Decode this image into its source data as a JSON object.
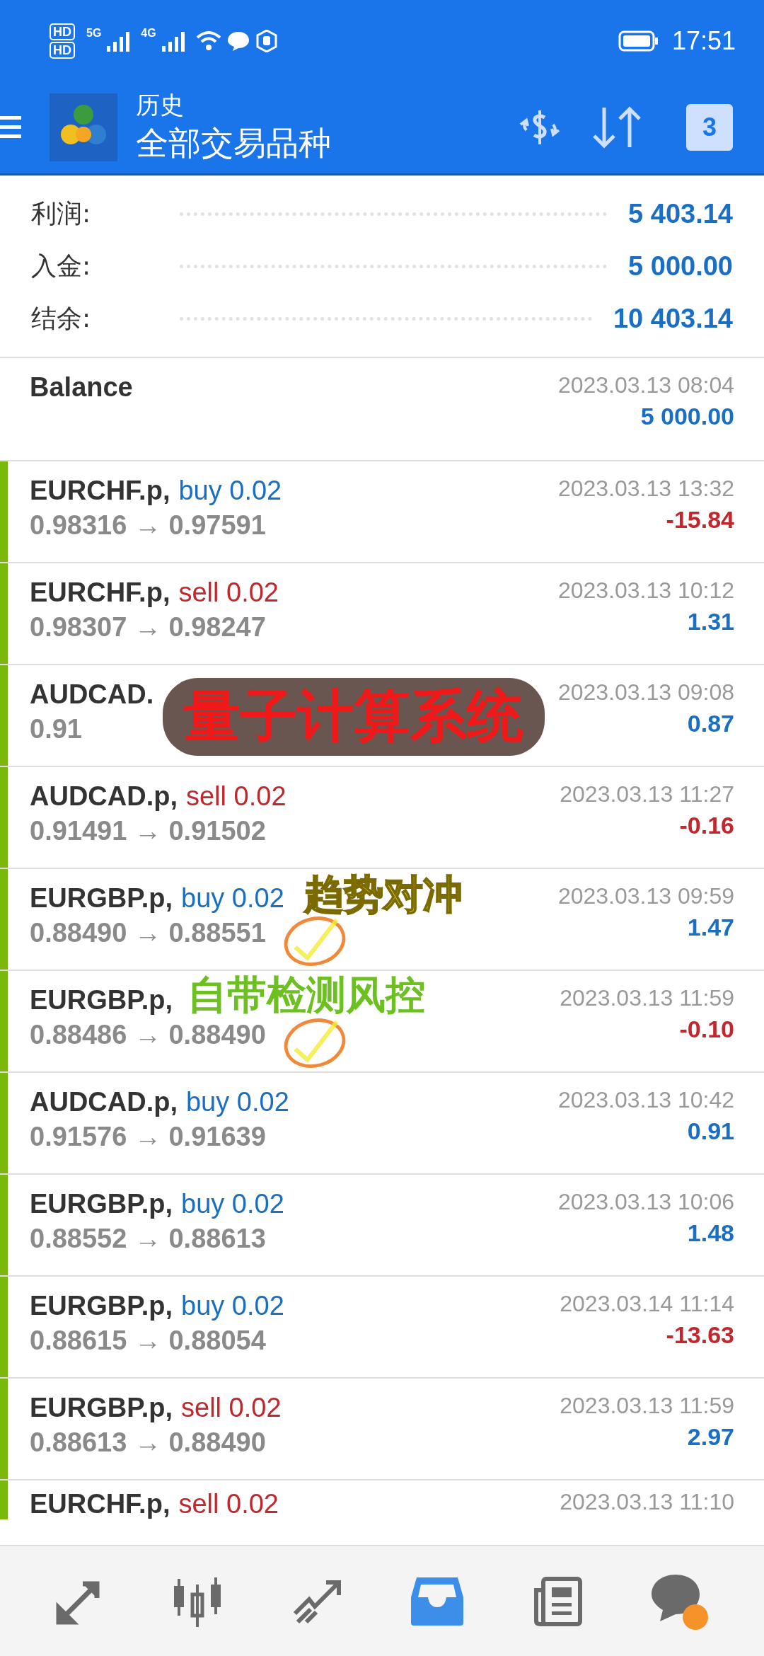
{
  "status_bar": {
    "sims": [
      "HD",
      "HD"
    ],
    "networks": [
      "5G",
      "4G"
    ],
    "time": "17:51"
  },
  "header": {
    "title": "历史",
    "subtitle": "全部交易品种",
    "calendar_day": "3"
  },
  "summary": [
    {
      "label": "利润:",
      "value": "5 403.14"
    },
    {
      "label": "入金:",
      "value": "5 000.00"
    },
    {
      "label": "结余:",
      "value": "10 403.14"
    }
  ],
  "balance": {
    "label": "Balance",
    "date": "2023.03.13 08:04",
    "amount": "5 000.00"
  },
  "trades": [
    {
      "symbol": "EURCHF.p,",
      "kind": "buy",
      "order": "buy 0.02",
      "prices": "0.98316 → 0.97591",
      "date": "2023.03.13 13:32",
      "profit": "-15.84",
      "loss": true,
      "marked": false
    },
    {
      "symbol": "EURCHF.p,",
      "kind": "sell",
      "order": "sell 0.02",
      "prices": "0.98307 → 0.98247",
      "date": "2023.03.13 10:12",
      "profit": "1.31",
      "loss": false,
      "marked": false
    },
    {
      "symbol": "AUDCAD.",
      "prices": "0.91",
      "date": "2023.03.13 09:08",
      "profit": "0.87",
      "loss": false,
      "marked": false,
      "sticker": {
        "kind": "banner",
        "text": "量子计算系统"
      }
    },
    {
      "symbol": "AUDCAD.p,",
      "kind": "sell",
      "order": "sell 0.02",
      "prices": "0.91491 → 0.91502",
      "date": "2023.03.13 11:27",
      "profit": "-0.16",
      "loss": true,
      "marked": false
    },
    {
      "symbol": "EURGBP.p,",
      "kind": "buy",
      "order": "buy 0.02",
      "prices": "0.88490 → 0.88551",
      "date": "2023.03.13 09:59",
      "profit": "1.47",
      "loss": false,
      "marked": true,
      "sticker": {
        "kind": "yellow",
        "text": "趋势对冲"
      }
    },
    {
      "symbol": "EURGBP.p,",
      "prices": "0.88486 → 0.88490",
      "date": "2023.03.13 11:59",
      "profit": "-0.10",
      "loss": true,
      "marked": true,
      "sticker": {
        "kind": "green",
        "text": "自带检测风控"
      }
    },
    {
      "symbol": "AUDCAD.p,",
      "kind": "buy",
      "order": "buy 0.02",
      "prices": "0.91576 → 0.91639",
      "date": "2023.03.13 10:42",
      "profit": "0.91",
      "loss": false,
      "marked": false
    },
    {
      "symbol": "EURGBP.p,",
      "kind": "buy",
      "order": "buy 0.02",
      "prices": "0.88552 → 0.88613",
      "date": "2023.03.13 10:06",
      "profit": "1.48",
      "loss": false,
      "marked": false
    },
    {
      "symbol": "EURGBP.p,",
      "kind": "buy",
      "order": "buy 0.02",
      "prices": "0.88615 → 0.88054",
      "date": "2023.03.14 11:14",
      "profit": "-13.63",
      "loss": true,
      "marked": false
    },
    {
      "symbol": "EURGBP.p,",
      "kind": "sell",
      "order": "sell 0.02",
      "prices": "0.88613 → 0.88490",
      "date": "2023.03.13 11:59",
      "profit": "2.97",
      "loss": false,
      "marked": false
    },
    {
      "symbol": "EURCHF.p,",
      "kind": "sell",
      "order": "sell 0.02",
      "date": "2023.03.13 11:10",
      "marked": false
    }
  ],
  "nav": [
    {
      "kind": "trade",
      "selected": false
    },
    {
      "kind": "candles",
      "selected": false
    },
    {
      "kind": "chart",
      "selected": false
    },
    {
      "kind": "inbox",
      "selected": true
    },
    {
      "kind": "news",
      "selected": false
    },
    {
      "kind": "chat",
      "selected": false,
      "badge": true
    }
  ]
}
